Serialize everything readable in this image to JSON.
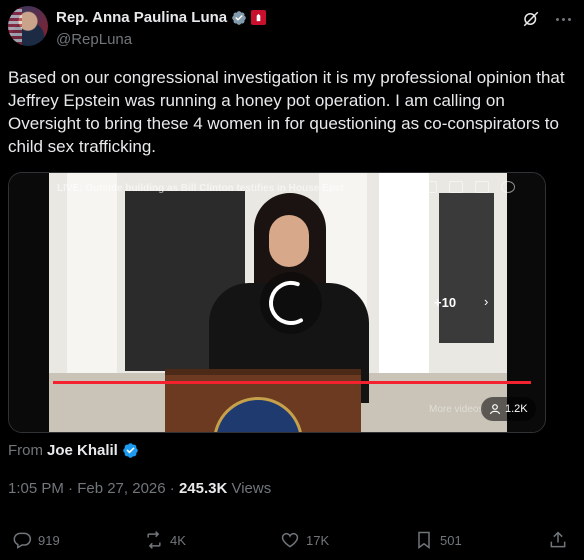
{
  "author": {
    "name": "Rep. Anna Paulina Luna",
    "handle": "@RepLuna"
  },
  "post": {
    "text": "Based on our congressional investigation it is my professional opinion that Jeffrey Epstein was running a honey pot operation. I am calling on Oversight to bring these 4 women in for questioning as co-conspirators to child sex trafficking."
  },
  "video": {
    "overlay_title": "LIVE: Outside building as Bill Clinton testifies in House Epst",
    "skip_label": "+10",
    "views": "1.2K",
    "more_videos": "More videos",
    "progress": 1.0,
    "progress_color": "#f4212e"
  },
  "attribution": {
    "prefix": "From",
    "source_name": "Joe Khalil"
  },
  "meta": {
    "timestamp": "1:05 PM · Feb 27, 2026 · ",
    "view_count": "245.3K",
    "views_label": "Views"
  },
  "actions": {
    "replies": "919",
    "reposts": "4K",
    "likes": "17K",
    "bookmarks": "501"
  },
  "colors": {
    "verified": "#1d9bf0",
    "muted": "#71767b",
    "text": "#e7e9ea",
    "background": "#000000"
  }
}
